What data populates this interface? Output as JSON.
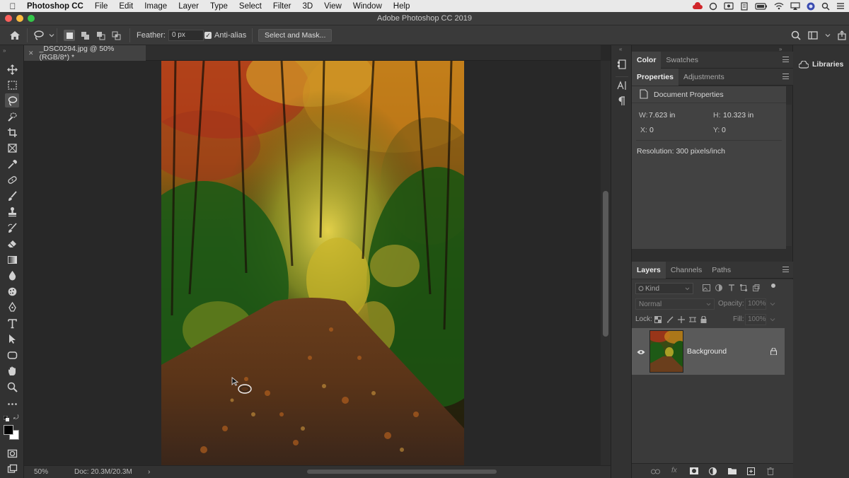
{
  "menubar": {
    "app_name": "Photoshop CC",
    "items": [
      "File",
      "Edit",
      "Image",
      "Layer",
      "Type",
      "Select",
      "Filter",
      "3D",
      "View",
      "Window",
      "Help"
    ]
  },
  "window": {
    "title": "Adobe Photoshop CC 2019"
  },
  "options": {
    "feather_label": "Feather:",
    "feather_value": "0 px",
    "antialias_label": "Anti-alias",
    "select_mask_label": "Select and Mask..."
  },
  "document": {
    "tab_label": "_DSC0294.jpg @ 50% (RGB/8*) *"
  },
  "status": {
    "zoom": "50%",
    "doc_size": "Doc: 20.3M/20.3M",
    "arrow": "›"
  },
  "color_panel": {
    "tabs": [
      "Color",
      "Swatches"
    ]
  },
  "properties_panel": {
    "tabs": [
      "Properties",
      "Adjustments"
    ],
    "header": "Document Properties",
    "w_label": "W:",
    "w_value": "7.623 in",
    "h_label": "H:",
    "h_value": "10.323 in",
    "x_label": "X:",
    "x_value": "0",
    "y_label": "Y:",
    "y_value": "0",
    "resolution": "Resolution: 300 pixels/inch"
  },
  "layers_panel": {
    "tabs": [
      "Layers",
      "Channels",
      "Paths"
    ],
    "filter_placeholder": "Kind",
    "blend_mode": "Normal",
    "opacity_label": "Opacity:",
    "opacity_value": "100%",
    "lock_label": "Lock:",
    "fill_label": "Fill:",
    "fill_value": "100%",
    "layers": [
      {
        "name": "Background"
      }
    ],
    "footer_fx": "fx"
  },
  "libraries": {
    "label": "Libraries"
  },
  "colors": {
    "close": "#fc605c",
    "minimize": "#fdbc40",
    "maximize": "#34c84a"
  }
}
